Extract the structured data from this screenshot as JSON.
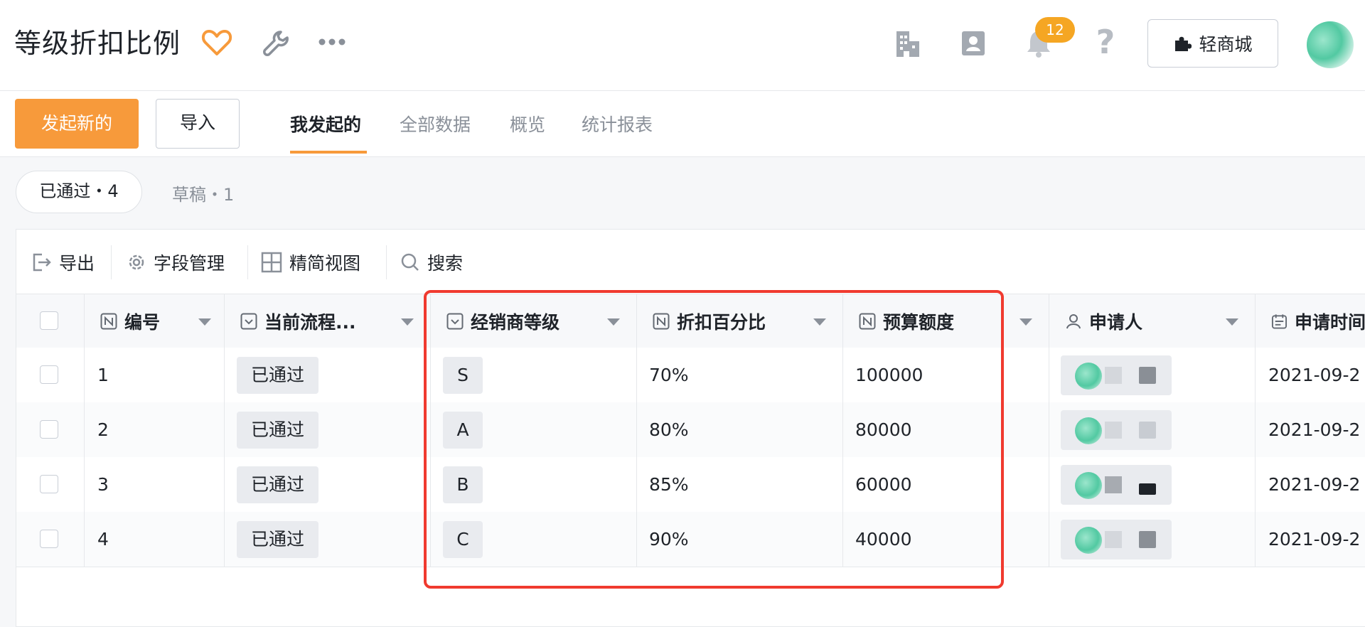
{
  "header": {
    "title": "等级折扣比例",
    "notification_count": "12",
    "help_symbol": "?",
    "shop_button_label": "轻商城",
    "icons": [
      "heart-icon",
      "wrench-icon",
      "more-icon",
      "building-icon",
      "contact-card-icon",
      "bell-icon",
      "help-icon",
      "puzzle-icon"
    ],
    "accent_color": "#f79a3b"
  },
  "subnav": {
    "new_button_label": "发起新的",
    "import_button_label": "导入",
    "tabs": [
      {
        "label": "我发起的",
        "active": true
      },
      {
        "label": "全部数据",
        "active": false
      },
      {
        "label": "概览",
        "active": false
      },
      {
        "label": "统计报表",
        "active": false
      }
    ]
  },
  "filters": {
    "approved": "已通过・4",
    "draft": "草稿・1"
  },
  "toolbar": {
    "export": "导出",
    "field_manage": "字段管理",
    "compact_view": "精简视图",
    "search": "搜索"
  },
  "table": {
    "columns": [
      {
        "label": "编号",
        "icon": "number-field-icon"
      },
      {
        "label": "当前流程...",
        "icon": "select-field-icon"
      },
      {
        "label": "经销商等级",
        "icon": "select-field-icon"
      },
      {
        "label": "折扣百分比",
        "icon": "number-field-icon"
      },
      {
        "label": "预算额度",
        "icon": "number-field-icon"
      },
      {
        "label": "申请人",
        "icon": "person-icon"
      },
      {
        "label": "申请时间",
        "icon": "calendar-icon"
      }
    ],
    "rows": [
      {
        "id": "1",
        "status": "已通过",
        "grade": "S",
        "discount": "70%",
        "budget": "100000",
        "date": "2021-09-2"
      },
      {
        "id": "2",
        "status": "已通过",
        "grade": "A",
        "discount": "80%",
        "budget": "80000",
        "date": "2021-09-2"
      },
      {
        "id": "3",
        "status": "已通过",
        "grade": "B",
        "discount": "85%",
        "budget": "60000",
        "date": "2021-09-2"
      },
      {
        "id": "4",
        "status": "已通过",
        "grade": "C",
        "discount": "90%",
        "budget": "40000",
        "date": "2021-09-2"
      }
    ]
  },
  "annotation_color": "#f03a2f"
}
